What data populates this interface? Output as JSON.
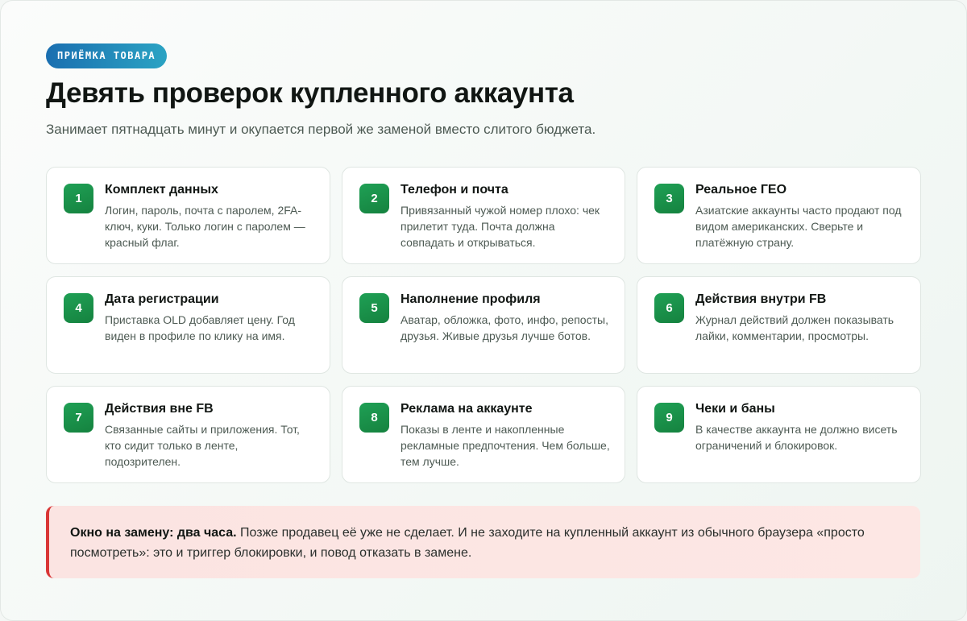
{
  "badge": "ПРИЁМКА ТОВАРА",
  "title": "Девять проверок купленного аккаунта",
  "subtitle": "Занимает пятнадцать минут и окупается первой же заменой вместо слитого бюджета.",
  "cards": [
    {
      "num": "1",
      "title": "Комплект данных",
      "text": "Логин, пароль, почта с паролем, 2FA-ключ, куки. Только логин с паролем — красный флаг."
    },
    {
      "num": "2",
      "title": "Телефон и почта",
      "text": "Привязанный чужой номер плохо: чек прилетит туда. Почта должна совпадать и открываться."
    },
    {
      "num": "3",
      "title": "Реальное ГЕО",
      "text": "Азиатские аккаунты часто продают под видом американских. Сверьте и платёжную страну."
    },
    {
      "num": "4",
      "title": "Дата регистрации",
      "text": "Приставка OLD добавляет цену. Год виден в профиле по клику на имя."
    },
    {
      "num": "5",
      "title": "Наполнение профиля",
      "text": "Аватар, обложка, фото, инфо, репосты, друзья. Живые друзья лучше ботов."
    },
    {
      "num": "6",
      "title": "Действия внутри FB",
      "text": "Журнал действий должен показывать лайки, комментарии, просмотры."
    },
    {
      "num": "7",
      "title": "Действия вне FB",
      "text": "Связанные сайты и приложения. Тот, кто сидит только в ленте, подозрителен."
    },
    {
      "num": "8",
      "title": "Реклама на аккаунте",
      "text": "Показы в ленте и накопленные рекламные предпочтения. Чем больше, тем лучше."
    },
    {
      "num": "9",
      "title": "Чеки и баны",
      "text": "В качестве аккаунта не должно висеть ограничений и блокировок."
    }
  ],
  "alert": {
    "lead": "Окно на замену: два часа.",
    "text": " Позже продавец её уже не сделает. И не заходите на купленный аккаунт из обычного браузера «просто посмотреть»: это и триггер блокировки, и повод отказать в замене."
  }
}
